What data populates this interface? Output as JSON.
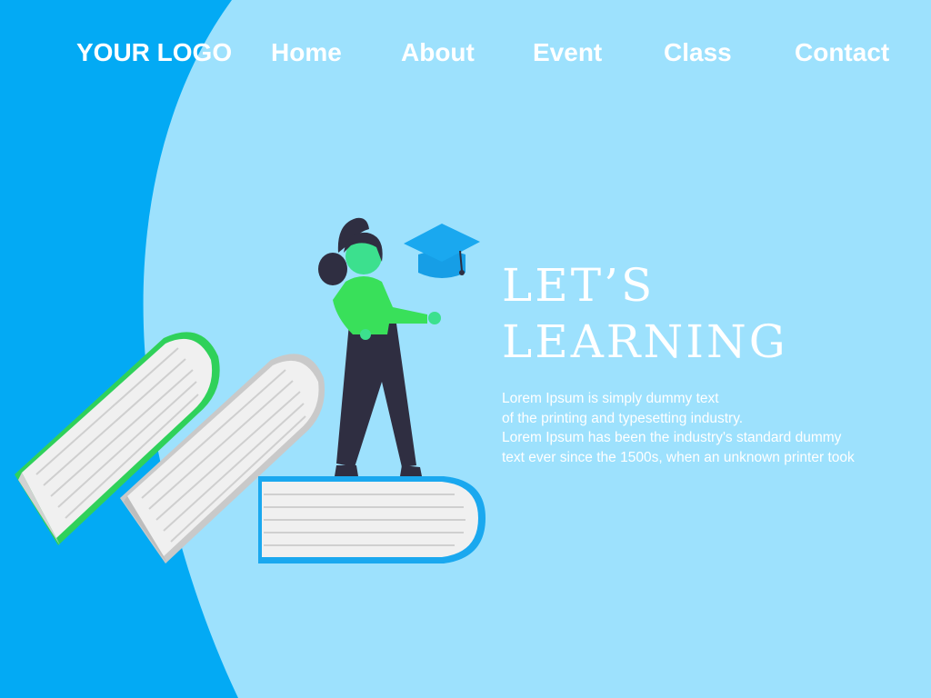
{
  "header": {
    "logo": "YOUR LOGO",
    "nav": [
      {
        "label": "Home"
      },
      {
        "label": "About"
      },
      {
        "label": "Event"
      },
      {
        "label": "Class"
      },
      {
        "label": "Contact"
      }
    ]
  },
  "hero": {
    "title_line1": "LET’S",
    "title_line2": "LEARNING",
    "description_lines": [
      "Lorem Ipsum is simply dummy text",
      "of the printing and typesetting industry.",
      "Lorem Ipsum has been the industry's standard dummy",
      "text ever since the 1500s, when an unknown printer took"
    ]
  },
  "colors": {
    "background_light": "#9de1fd",
    "background_dark": "#03aaf4",
    "accent_green": "#39e05a",
    "accent_blue": "#19a7f0",
    "text": "#ffffff"
  },
  "icons": {
    "illustration": "woman-standing-on-books-illustration",
    "cap": "graduation-cap-icon"
  }
}
